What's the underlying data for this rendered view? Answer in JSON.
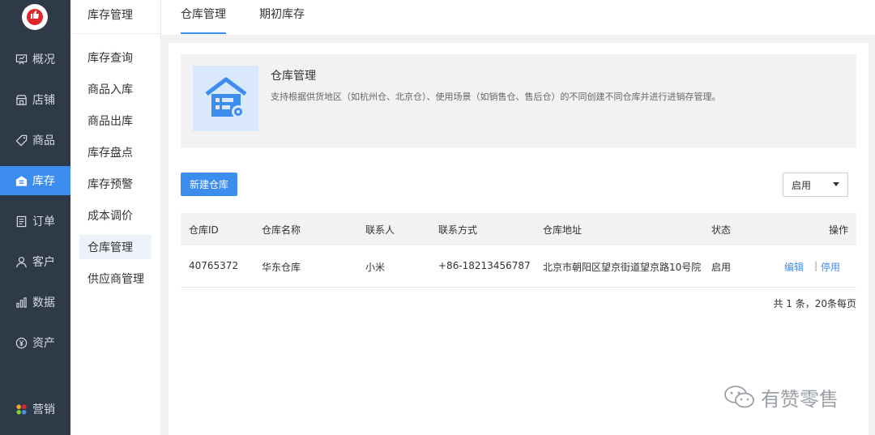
{
  "nav": {
    "items": [
      {
        "label": "概况",
        "icon": "overview-icon"
      },
      {
        "label": "店铺",
        "icon": "store-icon"
      },
      {
        "label": "商品",
        "icon": "tag-icon"
      },
      {
        "label": "库存",
        "icon": "inventory-icon",
        "active": true
      },
      {
        "label": "订单",
        "icon": "order-icon"
      },
      {
        "label": "客户",
        "icon": "customer-icon"
      },
      {
        "label": "数据",
        "icon": "chart-icon"
      },
      {
        "label": "资产",
        "icon": "yuan-icon"
      },
      {
        "label": "营销",
        "icon": "marketing-icon"
      }
    ]
  },
  "subnav": {
    "title": "库存管理",
    "items": [
      "库存查询",
      "商品入库",
      "商品出库",
      "库存盘点",
      "库存预警",
      "成本调价",
      "仓库管理",
      "供应商管理"
    ],
    "active_index": 6
  },
  "tabs": [
    "仓库管理",
    "期初库存"
  ],
  "banner": {
    "title": "仓库管理",
    "description": "支持根据供货地区（如杭州仓、北京仓）、使用场景（如销售仓、售后仓）的不同创建不同仓库并进行进销存管理。"
  },
  "toolbar": {
    "new_button": "新建仓库",
    "status_select": "启用"
  },
  "table": {
    "headers": [
      "仓库ID",
      "仓库名称",
      "联系人",
      "联系方式",
      "仓库地址",
      "状态",
      "操作"
    ],
    "rows": [
      {
        "id": "40765372",
        "name": "华东仓库",
        "contact": "小米",
        "phone": "+86-18213456787",
        "address": "北京市朝阳区望京街道望京路10号院",
        "status": "启用",
        "edit": "编辑",
        "disable": "停用"
      }
    ]
  },
  "pager": "共 1 条，20条每页",
  "watermark": "有赞零售",
  "colors": {
    "nav_bg": "#2f3a48",
    "accent": "#3d8dee"
  }
}
